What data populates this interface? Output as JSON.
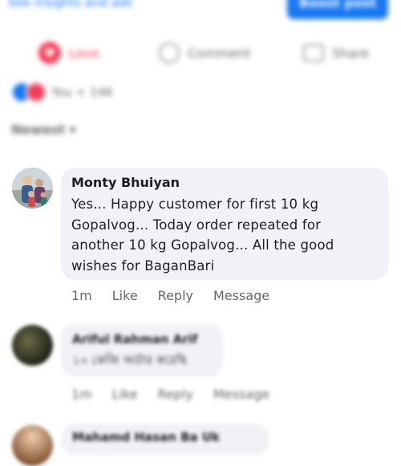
{
  "post": {
    "top_link": "See insights and ads",
    "boost_label": "Boost post",
    "actions": {
      "love": "Love",
      "comment": "Comment",
      "share": "Share"
    },
    "reactions_text": "You + 146",
    "sort_label": "Newest ▾"
  },
  "comments": [
    {
      "author": "Monty Bhuiyan",
      "text": "Yes... Happy customer for first 10 kg Gopalvog... Today order repeated for another 10 kg Gopalvog... All the good wishes for BaganBari",
      "time": "1m",
      "like": "Like",
      "reply": "Reply",
      "message": "Message"
    },
    {
      "author": "Ariful Rahman Arif",
      "text": "১০ কেজি অর্ডার করেছি",
      "time": "1m",
      "like": "Like",
      "reply": "Reply",
      "message": "Message"
    },
    {
      "author": "Mahamd Hasan Ba Uk"
    }
  ],
  "colors": {
    "accent": "#1877f2",
    "love": "#f33e58",
    "bubble": "#f0f2f5",
    "meta": "#65676b"
  }
}
